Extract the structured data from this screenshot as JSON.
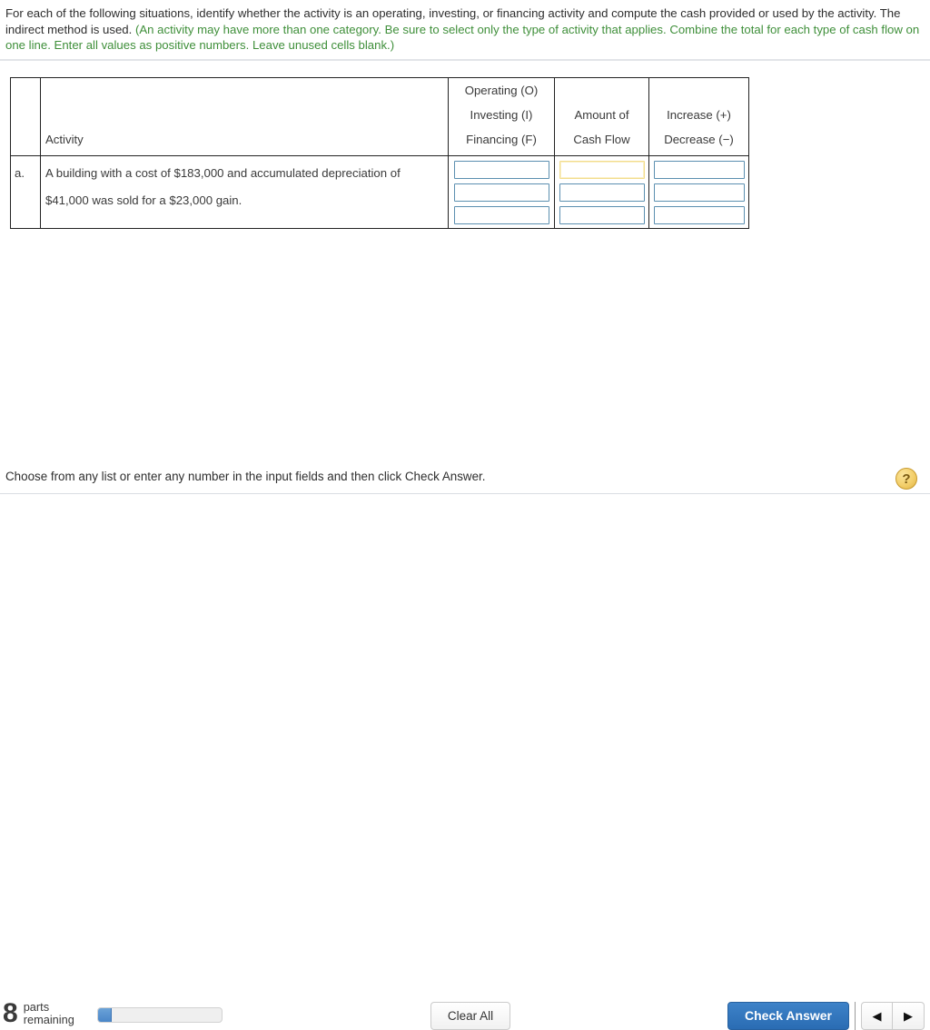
{
  "instruction": {
    "main_text": "For each of the following situations, identify whether the activity is an operating, investing, or financing activity and compute the cash provided or used by the activity. The indirect method is used. ",
    "hint_text": "(An activity may have more than one category. Be sure to select only the type of activity that applies. Combine the total for each type of cash flow on one line. Enter all values as positive numbers. Leave unused cells blank.)",
    "hint_color": "#3f8f3a"
  },
  "table": {
    "headers": {
      "letter": "",
      "activity": "Activity",
      "classification_line1": "Operating (O)",
      "classification_line2": "Investing (I)",
      "classification_line3": "Financing (F)",
      "amount_line1": "Amount of",
      "amount_line2": "Cash Flow",
      "sign_line1": "Increase (+)",
      "sign_line2": "Decrease (−)"
    },
    "rows": [
      {
        "letter": "a.",
        "activity_line1": "A building with a cost of $183,000 and accumulated depreciation of",
        "activity_line2": "$41,000 was sold for a $23,000 gain.",
        "classification_inputs": [
          "",
          "",
          ""
        ],
        "amount_inputs": [
          "",
          "",
          ""
        ],
        "sign_inputs": [
          "",
          "",
          ""
        ],
        "focused_input": "amount-0"
      }
    ]
  },
  "bottom_hint": {
    "text": "Choose from any list or enter any number in the input fields and then click Check Answer.",
    "help_icon": "?"
  },
  "toolbar": {
    "parts_count": "8",
    "parts_label_line1": "parts",
    "parts_label_line2": "remaining",
    "progress_percent": 11,
    "clear_all_label": "Clear All",
    "check_answer_label": "Check Answer",
    "prev_icon": "◀",
    "next_icon": "▶",
    "accent_color": "#2d74bd"
  }
}
